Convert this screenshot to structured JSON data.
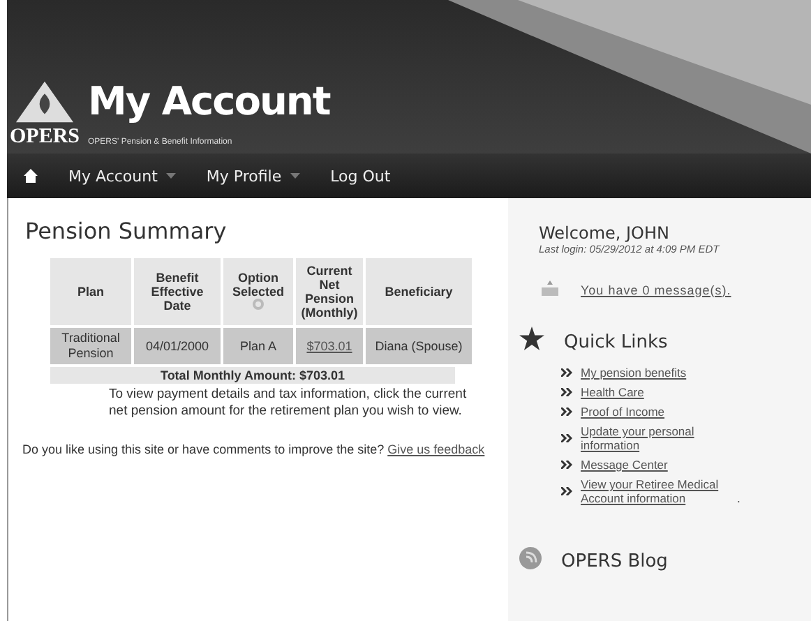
{
  "header": {
    "logo_text": "OPERS",
    "title": "My Account",
    "subtitle": "OPERS' Pension & Benefit Information"
  },
  "nav": [
    {
      "label": "My Account",
      "dropdown": true
    },
    {
      "label": "My Profile",
      "dropdown": true
    },
    {
      "label": "Log Out",
      "dropdown": false
    }
  ],
  "summary": {
    "title": "Pension Summary",
    "columns": [
      "Plan",
      "Benefit Effective Date",
      "Option Selected",
      "Current Net Pension (Monthly)",
      "Beneficiary"
    ],
    "rows": [
      {
        "cells": [
          "Traditional Pension",
          "04/01/2000",
          "Plan A",
          "$703.01",
          "Diana (Spouse)"
        ]
      }
    ],
    "total": "Total Monthly Amount: $703.01",
    "note": "To view payment details and tax information, click the current net pension amount for the retirement plan you wish to view."
  },
  "feedback": {
    "text": "Do you like using this site or have comments to improve the site?",
    "link": "Give us feedback"
  },
  "sidebar": {
    "welcome": "Welcome, JOHN",
    "last_login": "Last login: 05/29/2012 at 4:09 PM EDT",
    "messages": "You have 0 message(s).",
    "quick_links_title": "Quick Links",
    "links": [
      {
        "label": "My pension benefits"
      },
      {
        "label": "Health Care"
      },
      {
        "label": "Proof of Income"
      },
      {
        "label": "Update your personal information"
      },
      {
        "label": "Message Center"
      },
      {
        "label": "View your Retiree Medical Account information",
        "suffix": "."
      }
    ],
    "blog_title": "OPERS Blog"
  }
}
